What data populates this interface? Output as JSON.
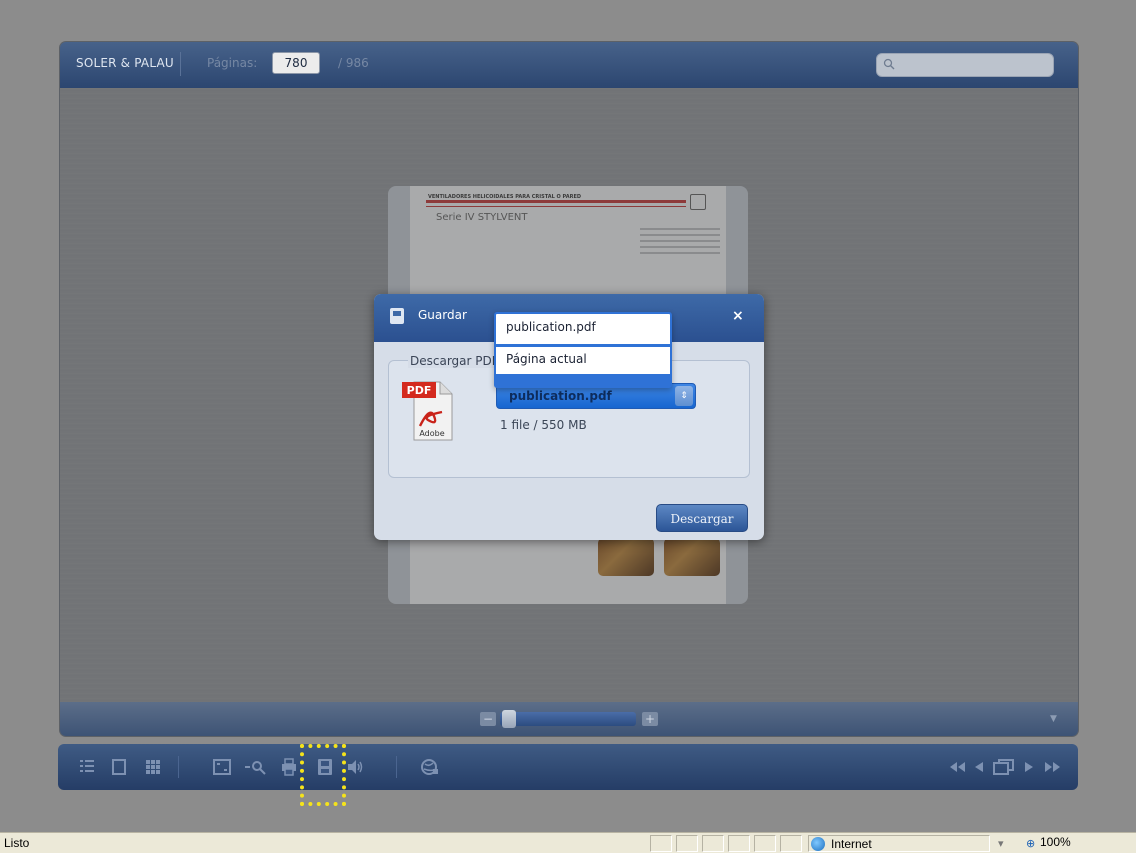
{
  "viewer": {
    "brand": "SOLER & PALAU",
    "pages_label": "Páginas:",
    "current_page": "780",
    "total_pages": "/ 986",
    "search_placeholder": "",
    "zoom_level": 0.05
  },
  "document": {
    "heading": "VENTILADORES HELICOIDALES PARA CRISTAL O PARED",
    "series": "Serie IV STYLVENT"
  },
  "toolbar": {
    "icons": [
      "table-of-contents-icon",
      "single-page-icon",
      "thumbnails-icon",
      "fullscreen-icon",
      "zoom-out-icon",
      "print-icon",
      "save-icon",
      "sound-icon",
      "share-icon",
      "first-page-icon",
      "previous-page-icon",
      "page-view-icon",
      "next-page-icon",
      "last-page-icon"
    ]
  },
  "dialog": {
    "title": "Guardar",
    "close_label": "×",
    "section_legend": "Descargar PDF",
    "selected_file": "publication.pdf",
    "file_info": "1 file / 550 MB",
    "download_button": "Descargar",
    "dropdown_options": [
      "publication.pdf",
      "Página actual"
    ],
    "pdf_icon_label": "PDF",
    "pdf_icon_brand": "Adobe"
  },
  "statusbar": {
    "status": "Listo",
    "zone": "Internet",
    "zoom": "100%"
  }
}
